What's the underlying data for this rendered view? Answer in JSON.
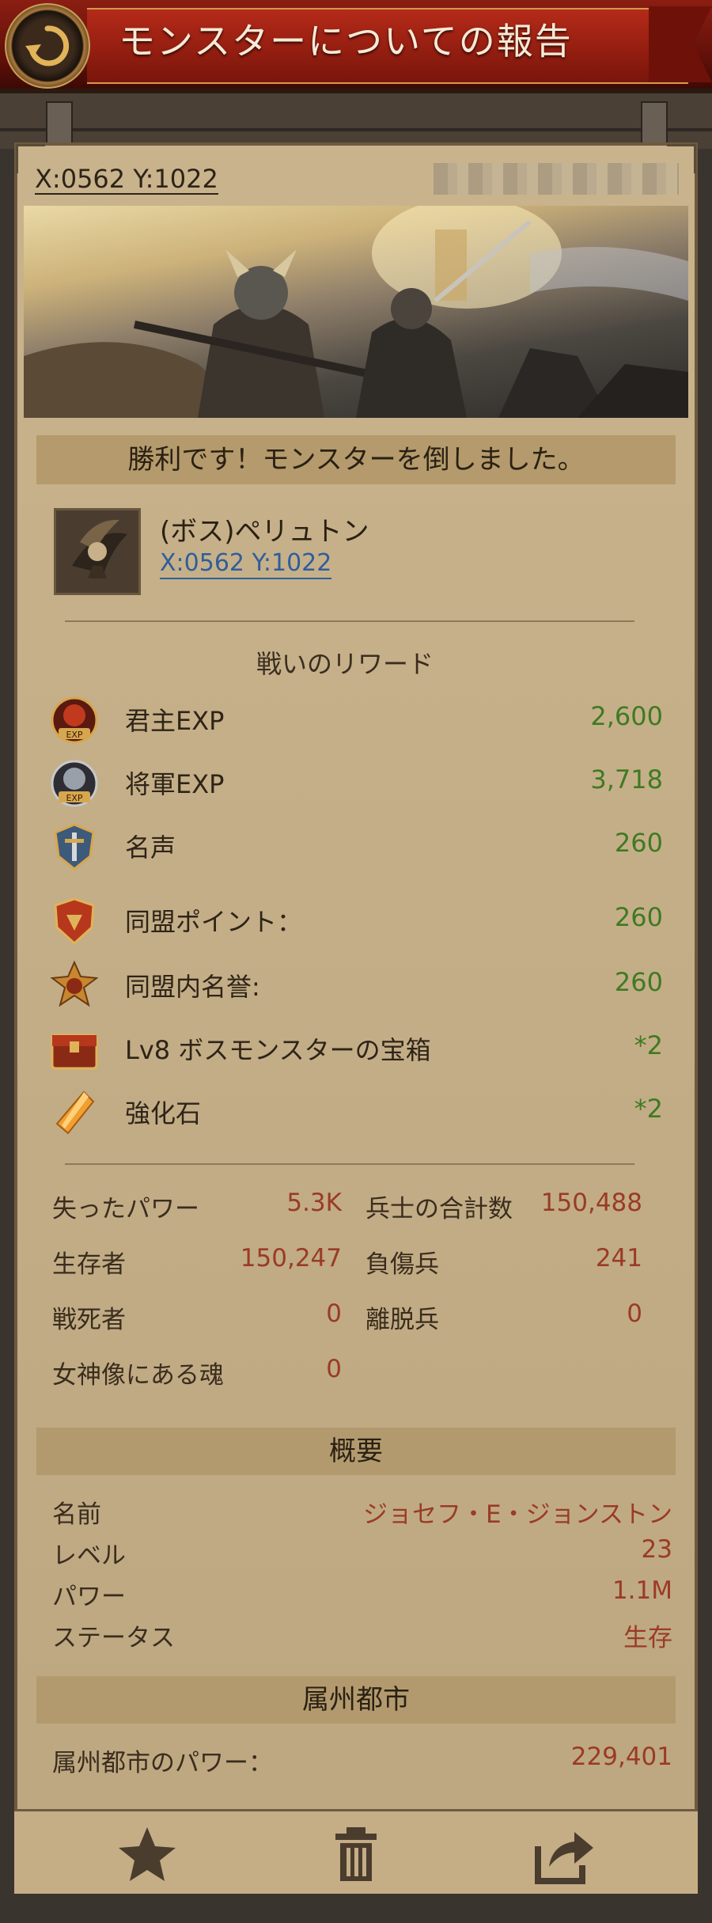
{
  "header": {
    "title": "モンスターについての報告",
    "back_icon": "back-arrow-icon"
  },
  "report": {
    "coords": "X:0562 Y:1022",
    "victory_text": "勝利です！モンスターを倒しました。",
    "boss": {
      "name": "(ボス)ペリュトン",
      "coords": "X:0562 Y:1022"
    }
  },
  "rewards": {
    "heading": "戦いのリワード",
    "items": [
      {
        "icon": "lord-exp-icon",
        "label": "君主EXP",
        "value": "2,600"
      },
      {
        "icon": "general-exp-icon",
        "label": "将軍EXP",
        "value": "3,718"
      },
      {
        "icon": "fame-icon",
        "label": "名声",
        "value": "260"
      },
      {
        "icon": "alliance-points-icon",
        "label": "同盟ポイント：",
        "value": "260"
      },
      {
        "icon": "alliance-honor-icon",
        "label": "同盟内名誉:",
        "value": "260"
      },
      {
        "icon": "treasure-chest-icon",
        "label": "Lv8 ボスモンスターの宝箱",
        "value": "*2"
      },
      {
        "icon": "enhancement-stone-icon",
        "label": "強化石",
        "value": "*2"
      }
    ]
  },
  "battle_stats": {
    "lost_power_label": "失ったパワー",
    "lost_power": "5.3K",
    "total_troops_label": "兵士の合計数",
    "total_troops": "150,488",
    "survivors_label": "生存者",
    "survivors": "150,247",
    "wounded_label": "負傷兵",
    "wounded": "241",
    "dead_label": "戦死者",
    "dead": "0",
    "deserters_label": "離脱兵",
    "deserters": "0",
    "souls_label": "女神像にある魂",
    "souls": "0"
  },
  "summary": {
    "heading": "概要",
    "name_label": "名前",
    "name": "ジョセフ・E・ジョンストン",
    "level_label": "レベル",
    "level": "23",
    "power_label": "パワー",
    "power": "1.1M",
    "status_label": "ステータス",
    "status": "生存"
  },
  "city": {
    "heading": "属州都市",
    "power_label": "属州都市のパワー：",
    "power": "229,401"
  },
  "toolbar": {
    "favorite_icon": "star-icon",
    "delete_icon": "trash-icon",
    "share_icon": "share-icon"
  },
  "colors": {
    "header_red": "#8b1e12",
    "panel_parchment": "#c7b088",
    "reward_green": "#3f7a22",
    "stat_red": "#9a3b25",
    "link_blue": "#2f5e9a"
  }
}
